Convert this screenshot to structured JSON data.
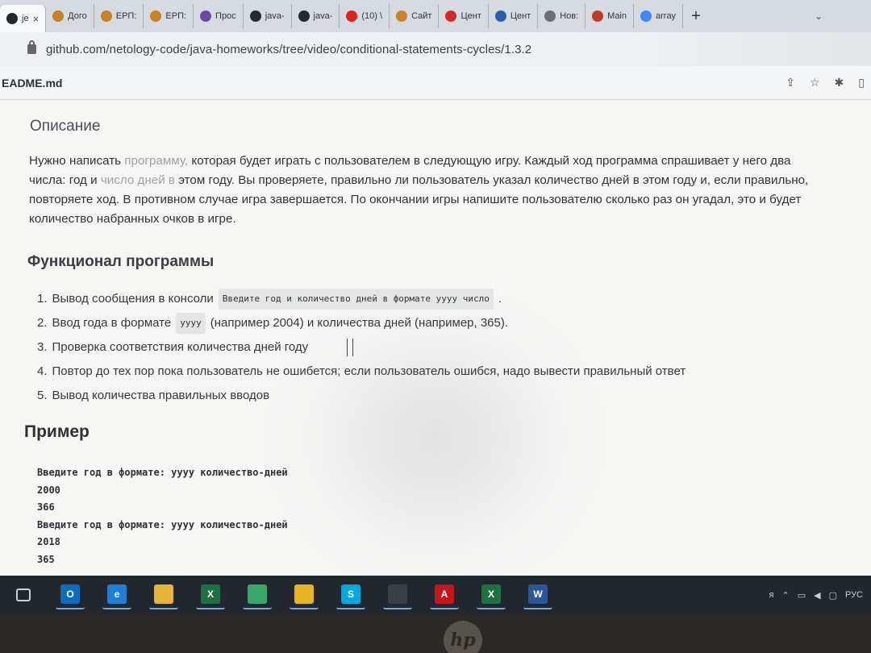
{
  "browser": {
    "tabs": [
      {
        "label": "je",
        "icon": "github-icon",
        "color": "#24292e",
        "active": true
      },
      {
        "label": "Дого",
        "icon": "sberbank-icon",
        "color": "#c9822a"
      },
      {
        "label": "ЕРП:",
        "icon": "sberbank-icon",
        "color": "#c9822a"
      },
      {
        "label": "ЕРП:",
        "icon": "sberbank-icon",
        "color": "#c9822a"
      },
      {
        "label": "Прос",
        "icon": "slack-icon",
        "color": "#6b4c9a"
      },
      {
        "label": "java-",
        "icon": "github-icon",
        "color": "#24292e"
      },
      {
        "label": "java-",
        "icon": "github-icon",
        "color": "#24292e"
      },
      {
        "label": "(10) \\",
        "icon": "youtube-icon",
        "color": "#e02020"
      },
      {
        "label": "Сайт",
        "icon": "sberbank-icon",
        "color": "#c9822a"
      },
      {
        "label": "Цент",
        "icon": "map-pin-icon",
        "color": "#d12b2b"
      },
      {
        "label": "Цент",
        "icon": "map-pin-icon",
        "color": "#2a5ea8"
      },
      {
        "label": "Нов:",
        "icon": "chrome-icon",
        "color": "#6c6f73"
      },
      {
        "label": "Main",
        "icon": "app-icon",
        "color": "#c0392b"
      },
      {
        "label": "array",
        "icon": "google-icon",
        "color": "#4285f4"
      }
    ],
    "new_tab": "+",
    "close": "×",
    "url": "github.com/netology-code/java-homeworks/tree/video/conditional-statements-cycles/1.3.2"
  },
  "readme": {
    "title": "EADME.md"
  },
  "content": {
    "description_heading": "Описание",
    "description_lines": [
      [
        "Нужно написать ",
        "программу, ",
        "которая будет играть с пользователем в следующую игру. Каждый ход программа спрашивает у него два"
      ],
      [
        "числа: год и ",
        "число дней в ",
        "этом году. Вы проверяете, правильно ли пользователь указал количество дней в этом году и, если правильно,"
      ],
      [
        "повторяете ход. В противном случае игра завершается. По окончании игры напишите пользователю сколько раз он угадал, это и будет",
        "",
        ""
      ],
      [
        "количество набранных очков в игре.",
        "",
        ""
      ]
    ],
    "functional_heading": "Функционал программы",
    "functional_items": [
      {
        "num": "1.",
        "before": "Вывод сообщения в консоли",
        "code": "Введите год и количество дней в формате yyyy число",
        "after": "."
      },
      {
        "num": "2.",
        "before": "Ввод года в формате",
        "code": "yyyy",
        "after": "(например 2004) и количества дней (например, 365)."
      },
      {
        "num": "3.",
        "before": "Проверка соответствия количества дней году",
        "code": "",
        "after": ""
      },
      {
        "num": "4.",
        "before": "Повтор до тех пор пока пользователь не ошибется; если пользователь ошибся, надо вывести правильный ответ",
        "code": "",
        "after": ""
      },
      {
        "num": "5.",
        "before": "Вывод количества правильных вводов",
        "code": "",
        "after": ""
      }
    ],
    "example_heading": "Пример",
    "example_lines": [
      "Введите год в формате: yyyy количество-дней",
      "2000",
      "366",
      "Введите год в формате: yyyy количество-дней",
      "2018",
      "365"
    ]
  },
  "taskbar": {
    "items": [
      {
        "name": "task-view-icon",
        "label": "",
        "color": "#22272e"
      },
      {
        "name": "outlook-icon",
        "label": "O",
        "color": "#0f6cbd"
      },
      {
        "name": "edge-icon",
        "label": "e",
        "color": "#1f7fd8"
      },
      {
        "name": "file-explorer-icon",
        "label": "",
        "color": "#e8b33a"
      },
      {
        "name": "excel-icon",
        "label": "X",
        "color": "#1e7145"
      },
      {
        "name": "network-app-icon",
        "label": "",
        "color": "#3aa86b"
      },
      {
        "name": "chrome-icon",
        "label": "",
        "color": "#e6b422"
      },
      {
        "name": "skype-icon",
        "label": "S",
        "color": "#00a7e1"
      },
      {
        "name": "snipping-tool-icon",
        "label": "",
        "color": "#3a3f46"
      },
      {
        "name": "acrobat-icon",
        "label": "A",
        "color": "#c4161c"
      },
      {
        "name": "excel-icon",
        "label": "X",
        "color": "#1e7145"
      },
      {
        "name": "word-icon",
        "label": "W",
        "color": "#2b579a"
      }
    ],
    "tray_language": "РУС"
  },
  "device": {
    "logo_text": "hp"
  }
}
